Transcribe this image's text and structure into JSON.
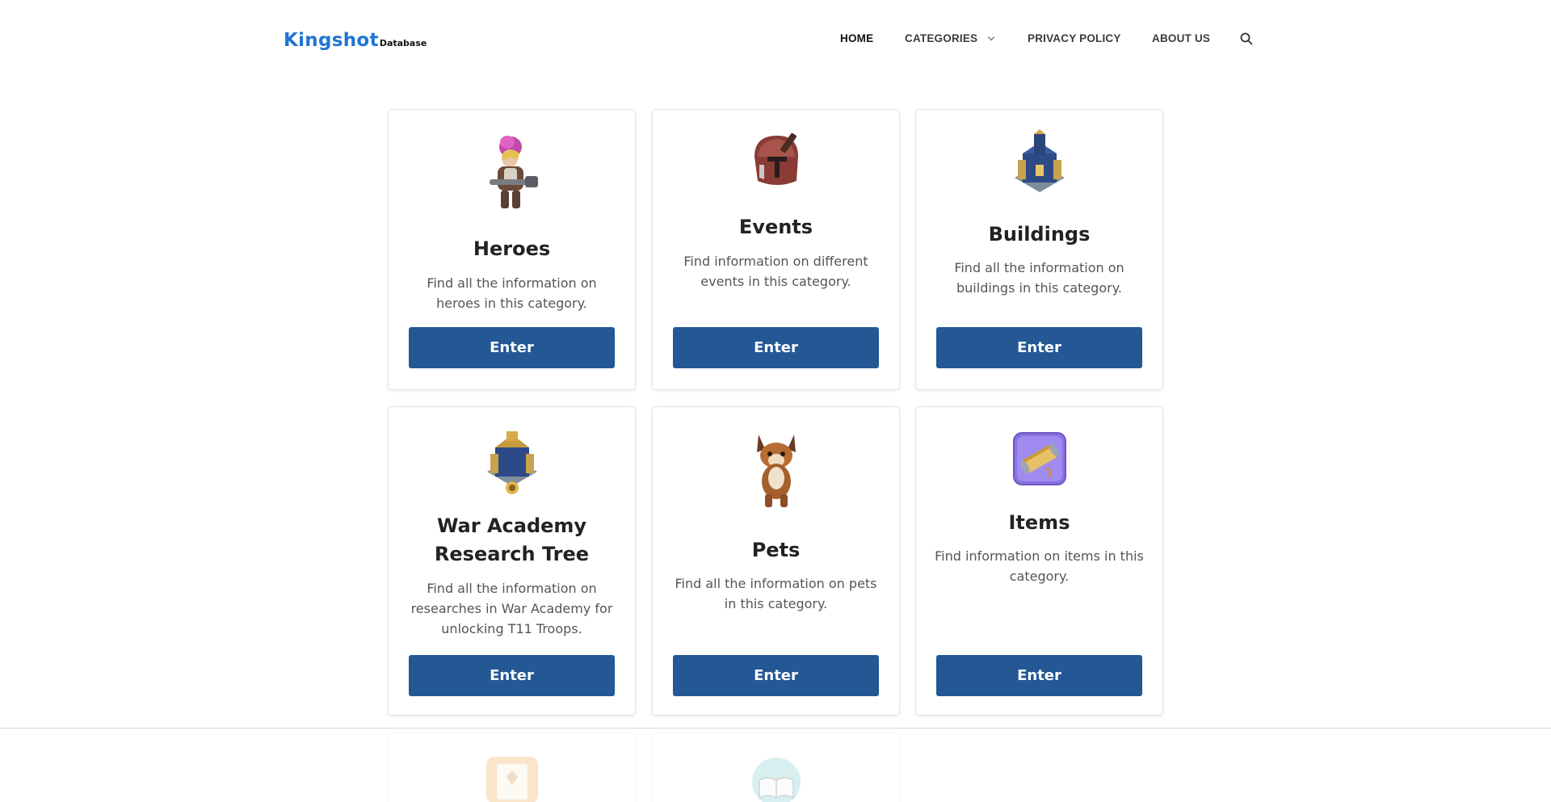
{
  "logo": {
    "main": "Kingshot",
    "sub": "Database"
  },
  "nav": {
    "home": "HOME",
    "categories": "CATEGORIES",
    "privacy": "PRIVACY POLICY",
    "about": "ABOUT US"
  },
  "colors": {
    "accent": "#235895",
    "logo": "#1f74d6"
  },
  "cards": [
    {
      "title": "Heroes",
      "desc": "Find all the information on heroes in this category.",
      "button": "Enter",
      "icon": "hero-portrait-icon"
    },
    {
      "title": "Events",
      "desc": "Find information on different events in this category.",
      "button": "Enter",
      "icon": "helmet-icon"
    },
    {
      "title": "Buildings",
      "desc": "Find all the information on buildings in this category.",
      "button": "Enter",
      "icon": "castle-icon"
    },
    {
      "title": "War Academy Research Tree",
      "desc": "Find all the information on researches in War Academy for unlocking T11 Troops.",
      "button": "Enter",
      "icon": "war-academy-icon"
    },
    {
      "title": "Pets",
      "desc": "Find all the information on pets in this category.",
      "button": "Enter",
      "icon": "lynx-pet-icon"
    },
    {
      "title": "Items",
      "desc": "Find information on items in this category.",
      "button": "Enter",
      "icon": "scroll-item-icon"
    }
  ],
  "partial_cards": [
    {
      "icon": "map-scroll-icon"
    },
    {
      "icon": "book-icon"
    }
  ]
}
